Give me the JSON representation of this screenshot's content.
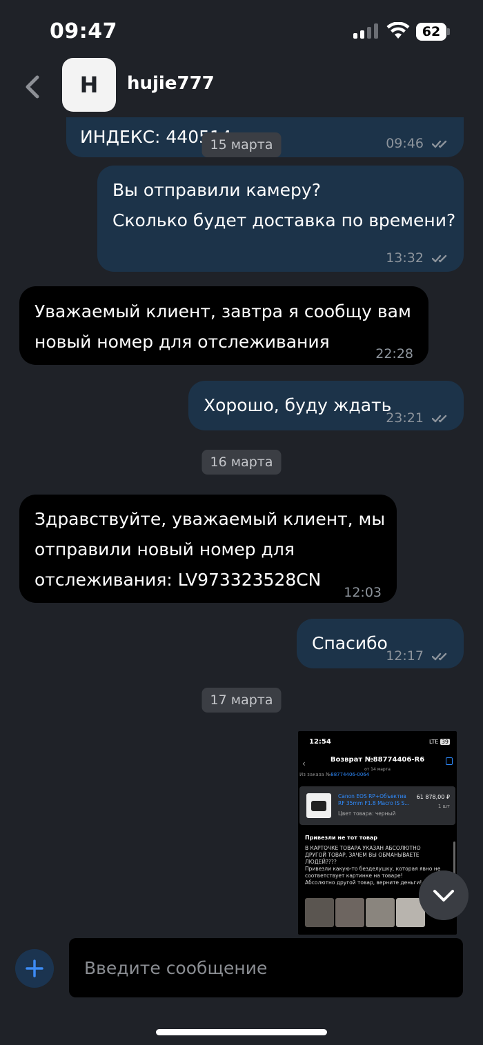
{
  "status_bar": {
    "time": "09:47",
    "battery": "62",
    "icons": [
      "cellular-signal-icon",
      "wifi-icon",
      "battery-icon"
    ]
  },
  "header": {
    "avatar_initial": "H",
    "contact_name": "hujie777",
    "back_icon": "chevron-left-icon"
  },
  "messages": [
    {
      "direction": "out",
      "text": "ИНДЕКС: 440514",
      "time": "09:46",
      "read": true
    },
    {
      "direction": "out",
      "text": "Вы отправили камеру?\nСколько будет доставка по времени?",
      "time": "13:32",
      "read": true
    },
    {
      "direction": "in",
      "text": "Уважаемый клиент, завтра я сообщу вам\nновый номер для отслеживания",
      "time": "22:28"
    },
    {
      "direction": "out",
      "text": "Хорошо, буду ждать",
      "time": "23:21",
      "read": true
    },
    {
      "direction": "in",
      "text": "Здравствуйте, уважаемый клиент, мы\nотправили новый номер для\nотслеживания: LV973323528CN",
      "time": "12:03"
    },
    {
      "direction": "out",
      "text": "Спасибо",
      "time": "12:17",
      "read": true
    }
  ],
  "date_separators": [
    "15 марта",
    "16 марта",
    "17 марта"
  ],
  "attachment": {
    "time": "12:54",
    "network": "LTE",
    "battery": "39",
    "title": "Возврат №88774406-R6",
    "subtitle": "от 14 марта",
    "order_prefix": "Из заказа №",
    "order_number": "88774406-0064",
    "product_name": "Canon EOS RP+Объектив RF 35mm F1.8 Macro IS S...",
    "price": "61 878,00 ₽",
    "quantity": "1 шт",
    "color": "Цвет товара: черный",
    "reason_title": "Привезли не тот товар",
    "reason_text": "В КАРТОЧКЕ ТОВАРА УКАЗАН АБСОЛЮТНО\nДРУГОЙ ТОВАР, ЗАЧЕМ ВЫ ОБМАНЫВАЕТЕ\nЛЮДЕЙ????\nПривезли какую-то безделушку, которая явно не\nсоответствует картинке на товаре!\nАбсолютно другой товар, верните деньги!"
  },
  "scroll_down_icon": "chevron-down-icon",
  "composer": {
    "add_icon": "plus-icon",
    "placeholder": "Введите сообщение"
  },
  "colors": {
    "background": "#1f2228",
    "outgoing_bubble": "#1c3349",
    "incoming_bubble": "#000000",
    "accent": "#2f8cff"
  }
}
